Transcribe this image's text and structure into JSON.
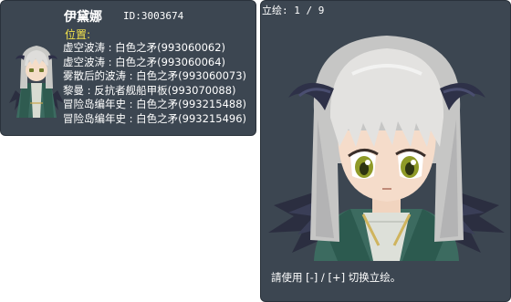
{
  "npc": {
    "name": "伊黛娜",
    "id_label": "ID:3003674"
  },
  "location": {
    "label": "位置:",
    "entries": [
      "虚空波涛 : 白色之矛(993060062)",
      "虚空波涛 : 白色之矛(993060064)",
      "雾散后的波涛 : 白色之矛(993060073)",
      "黎曼 : 反抗者舰船甲板(993070088)",
      "冒险岛编年史 : 白色之矛(993215488)",
      "冒险岛编年史 : 白色之矛(993215496)"
    ]
  },
  "portrait": {
    "title_prefix": "立绘:",
    "counter": " 1 / 9",
    "hint": "請使用 [-] / [+] 切换立绘。"
  },
  "colors": {
    "panel_bg": "#3c4651",
    "location_label": "#f2e24c",
    "text": "#ffffff"
  }
}
